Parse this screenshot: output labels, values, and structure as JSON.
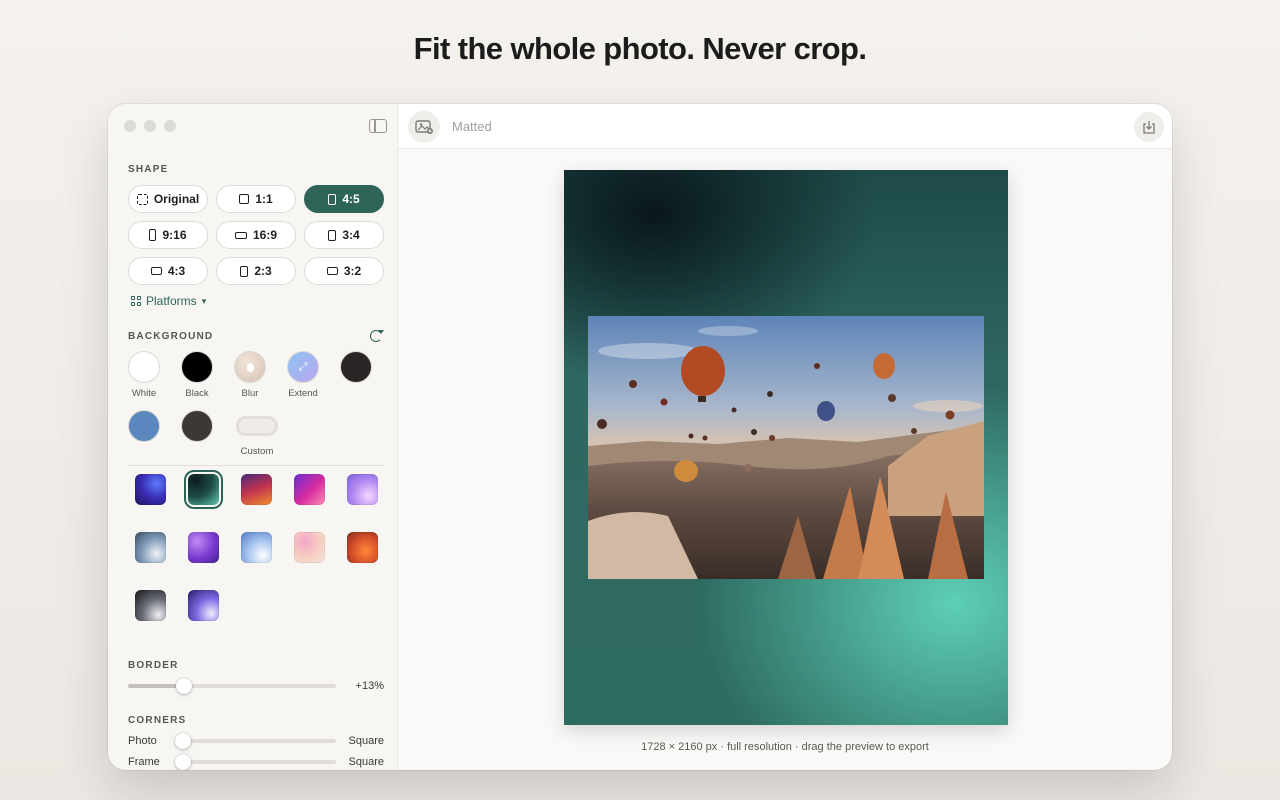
{
  "headline": "Fit the whole photo. Never crop.",
  "app": {
    "title": "Matted"
  },
  "shape": {
    "title": "SHAPE",
    "options": [
      {
        "label": "Original",
        "icon": "dashed-frame-icon"
      },
      {
        "label": "1:1",
        "icon": "square-icon"
      },
      {
        "label": "4:5",
        "icon": "portrait-icon",
        "active": true
      },
      {
        "label": "9:16",
        "icon": "tall-portrait-icon"
      },
      {
        "label": "16:9",
        "icon": "wide-landscape-icon"
      },
      {
        "label": "3:4",
        "icon": "portrait-icon"
      },
      {
        "label": "4:3",
        "icon": "landscape-icon"
      },
      {
        "label": "2:3",
        "icon": "portrait-icon"
      },
      {
        "label": "3:2",
        "icon": "landscape-icon"
      }
    ],
    "platforms_label": "Platforms"
  },
  "background": {
    "title": "BACKGROUND",
    "swatches": [
      {
        "label": "White",
        "color": "#ffffff"
      },
      {
        "label": "Black",
        "color": "#000000"
      },
      {
        "label": "Blur",
        "color": "#e9d8cc"
      },
      {
        "label": "Extend",
        "color": "#a9b6f0"
      },
      {
        "label": "",
        "color": "#2b2626"
      }
    ],
    "swatches_row2": [
      {
        "label": "",
        "color": "#5a87bd"
      },
      {
        "label": "",
        "color": "#3d3735"
      },
      {
        "label": "Custom",
        "color": "#efece8"
      }
    ]
  },
  "border": {
    "title": "BORDER",
    "value": "+13%",
    "level": 0.27
  },
  "corners": {
    "title": "CORNERS",
    "photo_label": "Photo",
    "photo_value": "Square",
    "frame_label": "Frame",
    "frame_value": "Square"
  },
  "preview": {
    "caption": "1728 × 2160 px · full resolution · drag the preview to export"
  },
  "colors": {
    "accent": "#2e6458"
  }
}
